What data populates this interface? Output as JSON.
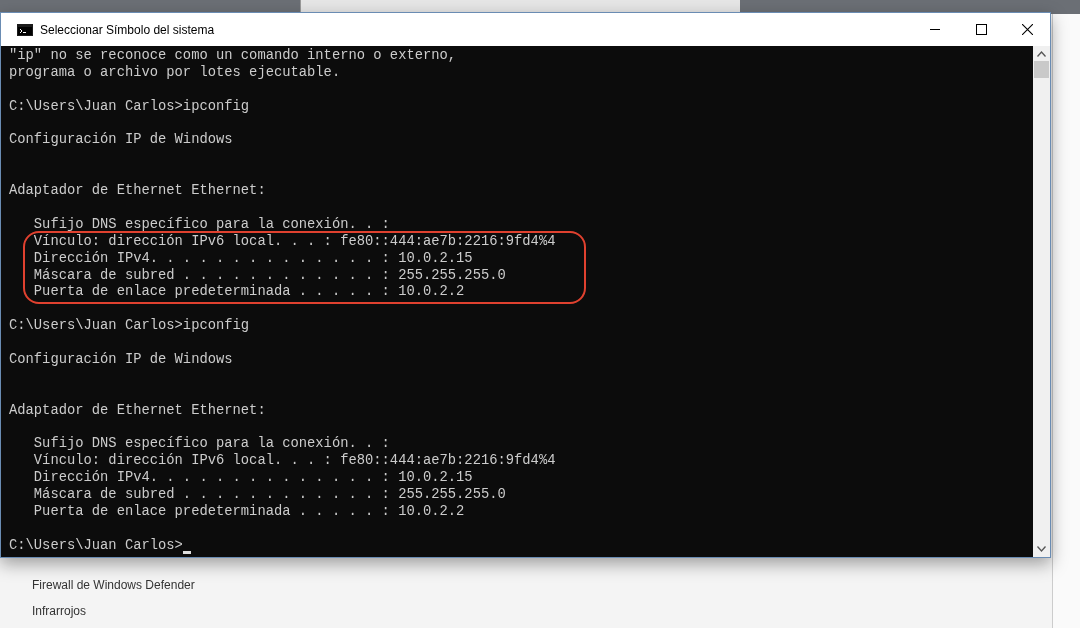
{
  "window": {
    "title": "Seleccionar Símbolo del sistema"
  },
  "console": {
    "cursor_visible": true,
    "lines": [
      {
        "kind": "text",
        "text": "\"ip\" no se reconoce como un comando interno o externo,",
        "highlighted": false
      },
      {
        "kind": "text",
        "text": "programa o archivo por lotes ejecutable.",
        "highlighted": false
      },
      {
        "kind": "blank"
      },
      {
        "kind": "text",
        "text": "C:\\Users\\Juan Carlos>ipconfig",
        "highlighted": false
      },
      {
        "kind": "blank"
      },
      {
        "kind": "text",
        "text": "Configuración IP de Windows",
        "highlighted": false
      },
      {
        "kind": "blank"
      },
      {
        "kind": "blank"
      },
      {
        "kind": "text",
        "text": "Adaptador de Ethernet Ethernet:",
        "highlighted": false
      },
      {
        "kind": "blank"
      },
      {
        "kind": "text",
        "text": "   Sufijo DNS específico para la conexión. . :",
        "highlighted": false
      },
      {
        "kind": "text",
        "text": "   Vínculo: dirección IPv6 local. . . : fe80::444:ae7b:2216:9fd4%4",
        "highlighted": true
      },
      {
        "kind": "text",
        "text": "   Dirección IPv4. . . . . . . . . . . . . . : 10.0.2.15",
        "highlighted": true
      },
      {
        "kind": "text",
        "text": "   Máscara de subred . . . . . . . . . . . . : 255.255.255.0",
        "highlighted": true
      },
      {
        "kind": "text",
        "text": "   Puerta de enlace predeterminada . . . . . : 10.0.2.2",
        "highlighted": true
      },
      {
        "kind": "blank"
      },
      {
        "kind": "text",
        "text": "C:\\Users\\Juan Carlos>ipconfig",
        "highlighted": false
      },
      {
        "kind": "blank"
      },
      {
        "kind": "text",
        "text": "Configuración IP de Windows",
        "highlighted": false
      },
      {
        "kind": "blank"
      },
      {
        "kind": "blank"
      },
      {
        "kind": "text",
        "text": "Adaptador de Ethernet Ethernet:",
        "highlighted": false
      },
      {
        "kind": "blank"
      },
      {
        "kind": "text",
        "text": "   Sufijo DNS específico para la conexión. . :",
        "highlighted": false
      },
      {
        "kind": "text",
        "text": "   Vínculo: dirección IPv6 local. . . : fe80::444:ae7b:2216:9fd4%4",
        "highlighted": false
      },
      {
        "kind": "text",
        "text": "   Dirección IPv4. . . . . . . . . . . . . . : 10.0.2.15",
        "highlighted": false
      },
      {
        "kind": "text",
        "text": "   Máscara de subred . . . . . . . . . . . . : 255.255.255.0",
        "highlighted": false
      },
      {
        "kind": "text",
        "text": "   Puerta de enlace predeterminada . . . . . : 10.0.2.2",
        "highlighted": false
      },
      {
        "kind": "blank"
      },
      {
        "kind": "text",
        "text": "C:\\Users\\Juan Carlos>",
        "highlighted": false
      }
    ]
  },
  "background_window": {
    "links": [
      "Firewall de Windows Defender",
      "Infrarrojos"
    ]
  }
}
